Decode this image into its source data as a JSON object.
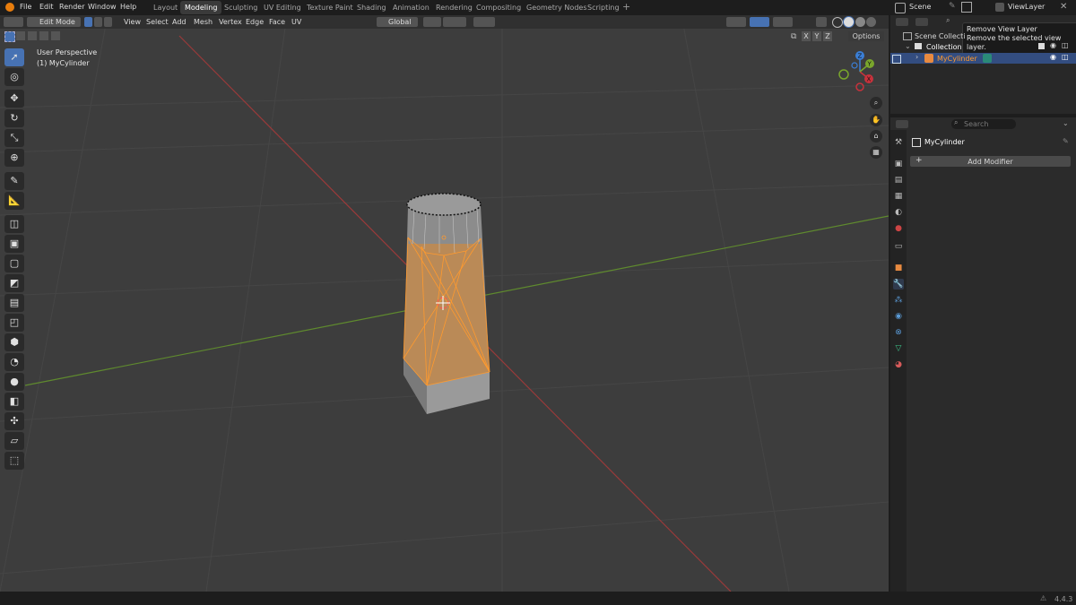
{
  "menu": [
    "File",
    "Edit",
    "Render",
    "Window",
    "Help"
  ],
  "workspaces": [
    "Layout",
    "Modeling",
    "Sculpting",
    "UV Editing",
    "Texture Paint",
    "Shading",
    "Animation",
    "Rendering",
    "Compositing",
    "Geometry Nodes",
    "Scripting"
  ],
  "active_workspace": "Modeling",
  "scene_label": "Scene",
  "view_layer_label": "ViewLayer",
  "viewport": {
    "mode": "Edit Mode",
    "menus": [
      "View",
      "Select",
      "Add",
      "Mesh",
      "Vertex",
      "Edge",
      "Face",
      "UV"
    ],
    "orientation": "Global",
    "perspective_label": "User Perspective",
    "object_label": "(1) MyCylinder",
    "axis_labels": {
      "x": "X",
      "y": "Y",
      "z": "Z"
    },
    "mirror_axes": [
      "X",
      "Y",
      "Z"
    ],
    "options_label": "Options"
  },
  "tooltip": {
    "title": "Remove View Layer",
    "desc": "Remove the selected view layer."
  },
  "outliner": {
    "scene_collection": "Scene Collecti",
    "collection": "Collection",
    "object": "MyCylinder"
  },
  "properties": {
    "search_placeholder": "Search",
    "object_name": "MyCylinder",
    "add_modifier": "Add Modifier"
  },
  "status": {
    "version": "4.4.3"
  },
  "colors": {
    "accent": "#4772b3",
    "selection": "#ff9a2e",
    "x_axis": "#c8323c",
    "y_axis": "#7aa62c",
    "z_axis": "#3b7fd6"
  }
}
